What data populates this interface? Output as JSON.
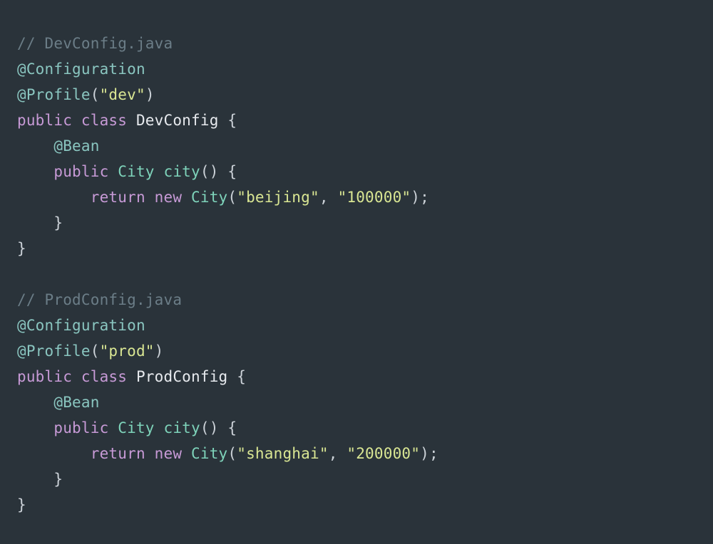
{
  "editor": {
    "language": "java",
    "background_color": "#2a333a",
    "theme": "dark-slate"
  },
  "palette": {
    "comment": "#6b7d87",
    "annotation": "#8ac6c0",
    "keyword": "#c79ad6",
    "type": "#7ed3ba",
    "method": "#7ed3ba",
    "classname": "#e7eaee",
    "string": "#d9e693",
    "punctuation": "#ccd2d8"
  },
  "code": {
    "lines": [
      {
        "index": 1,
        "indent": 0,
        "text": "// DevConfig.java",
        "tokens": [
          {
            "t": "// DevConfig.java",
            "k": "comment"
          }
        ]
      },
      {
        "index": 2,
        "indent": 0,
        "text": "@Configuration",
        "tokens": [
          {
            "t": "@Configuration",
            "k": "annotation"
          }
        ]
      },
      {
        "index": 3,
        "indent": 0,
        "text": "@Profile(\"dev\")",
        "tokens": [
          {
            "t": "@Profile",
            "k": "annotation"
          },
          {
            "t": "(",
            "k": "punct"
          },
          {
            "t": "\"dev\"",
            "k": "string"
          },
          {
            "t": ")",
            "k": "punct"
          }
        ]
      },
      {
        "index": 4,
        "indent": 0,
        "text": "public class DevConfig {",
        "tokens": [
          {
            "t": "public",
            "k": "keyword"
          },
          {
            "t": " ",
            "k": "plain"
          },
          {
            "t": "class",
            "k": "keyword"
          },
          {
            "t": " ",
            "k": "plain"
          },
          {
            "t": "DevConfig",
            "k": "classname"
          },
          {
            "t": " ",
            "k": "plain"
          },
          {
            "t": "{",
            "k": "punct"
          }
        ]
      },
      {
        "index": 5,
        "indent": 4,
        "text": "    @Bean",
        "tokens": [
          {
            "t": "    ",
            "k": "plain"
          },
          {
            "t": "@Bean",
            "k": "annotation"
          }
        ]
      },
      {
        "index": 6,
        "indent": 4,
        "text": "    public City city() {",
        "tokens": [
          {
            "t": "    ",
            "k": "plain"
          },
          {
            "t": "public",
            "k": "keyword"
          },
          {
            "t": " ",
            "k": "plain"
          },
          {
            "t": "City",
            "k": "type"
          },
          {
            "t": " ",
            "k": "plain"
          },
          {
            "t": "city",
            "k": "method"
          },
          {
            "t": "() {",
            "k": "punct"
          }
        ]
      },
      {
        "index": 7,
        "indent": 8,
        "text": "        return new City(\"beijing\", \"100000\");",
        "tokens": [
          {
            "t": "        ",
            "k": "plain"
          },
          {
            "t": "return",
            "k": "keyword"
          },
          {
            "t": " ",
            "k": "plain"
          },
          {
            "t": "new",
            "k": "keyword"
          },
          {
            "t": " ",
            "k": "plain"
          },
          {
            "t": "City",
            "k": "type"
          },
          {
            "t": "(",
            "k": "punct"
          },
          {
            "t": "\"beijing\"",
            "k": "string"
          },
          {
            "t": ", ",
            "k": "punct"
          },
          {
            "t": "\"100000\"",
            "k": "string"
          },
          {
            "t": ");",
            "k": "punct"
          }
        ]
      },
      {
        "index": 8,
        "indent": 4,
        "text": "    }",
        "tokens": [
          {
            "t": "    ",
            "k": "plain"
          },
          {
            "t": "}",
            "k": "punct"
          }
        ]
      },
      {
        "index": 9,
        "indent": 0,
        "text": "}",
        "tokens": [
          {
            "t": "}",
            "k": "punct"
          }
        ]
      },
      {
        "index": 10,
        "indent": 0,
        "text": "",
        "tokens": []
      },
      {
        "index": 11,
        "indent": 0,
        "text": "// ProdConfig.java",
        "tokens": [
          {
            "t": "// ProdConfig.java",
            "k": "comment"
          }
        ]
      },
      {
        "index": 12,
        "indent": 0,
        "text": "@Configuration",
        "tokens": [
          {
            "t": "@Configuration",
            "k": "annotation"
          }
        ]
      },
      {
        "index": 13,
        "indent": 0,
        "text": "@Profile(\"prod\")",
        "tokens": [
          {
            "t": "@Profile",
            "k": "annotation"
          },
          {
            "t": "(",
            "k": "punct"
          },
          {
            "t": "\"prod\"",
            "k": "string"
          },
          {
            "t": ")",
            "k": "punct"
          }
        ]
      },
      {
        "index": 14,
        "indent": 0,
        "text": "public class ProdConfig {",
        "tokens": [
          {
            "t": "public",
            "k": "keyword"
          },
          {
            "t": " ",
            "k": "plain"
          },
          {
            "t": "class",
            "k": "keyword"
          },
          {
            "t": " ",
            "k": "plain"
          },
          {
            "t": "ProdConfig",
            "k": "classname"
          },
          {
            "t": " ",
            "k": "plain"
          },
          {
            "t": "{",
            "k": "punct"
          }
        ]
      },
      {
        "index": 15,
        "indent": 4,
        "text": "    @Bean",
        "tokens": [
          {
            "t": "    ",
            "k": "plain"
          },
          {
            "t": "@Bean",
            "k": "annotation"
          }
        ]
      },
      {
        "index": 16,
        "indent": 4,
        "text": "    public City city() {",
        "tokens": [
          {
            "t": "    ",
            "k": "plain"
          },
          {
            "t": "public",
            "k": "keyword"
          },
          {
            "t": " ",
            "k": "plain"
          },
          {
            "t": "City",
            "k": "type"
          },
          {
            "t": " ",
            "k": "plain"
          },
          {
            "t": "city",
            "k": "method"
          },
          {
            "t": "() {",
            "k": "punct"
          }
        ]
      },
      {
        "index": 17,
        "indent": 8,
        "text": "        return new City(\"shanghai\", \"200000\");",
        "tokens": [
          {
            "t": "        ",
            "k": "plain"
          },
          {
            "t": "return",
            "k": "keyword"
          },
          {
            "t": " ",
            "k": "plain"
          },
          {
            "t": "new",
            "k": "keyword"
          },
          {
            "t": " ",
            "k": "plain"
          },
          {
            "t": "City",
            "k": "type"
          },
          {
            "t": "(",
            "k": "punct"
          },
          {
            "t": "\"shanghai\"",
            "k": "string"
          },
          {
            "t": ", ",
            "k": "punct"
          },
          {
            "t": "\"200000\"",
            "k": "string"
          },
          {
            "t": ");",
            "k": "punct"
          }
        ]
      },
      {
        "index": 18,
        "indent": 4,
        "text": "    }",
        "tokens": [
          {
            "t": "    ",
            "k": "plain"
          },
          {
            "t": "}",
            "k": "punct"
          }
        ]
      },
      {
        "index": 19,
        "indent": 0,
        "text": "}",
        "tokens": [
          {
            "t": "}",
            "k": "punct"
          }
        ]
      }
    ]
  }
}
